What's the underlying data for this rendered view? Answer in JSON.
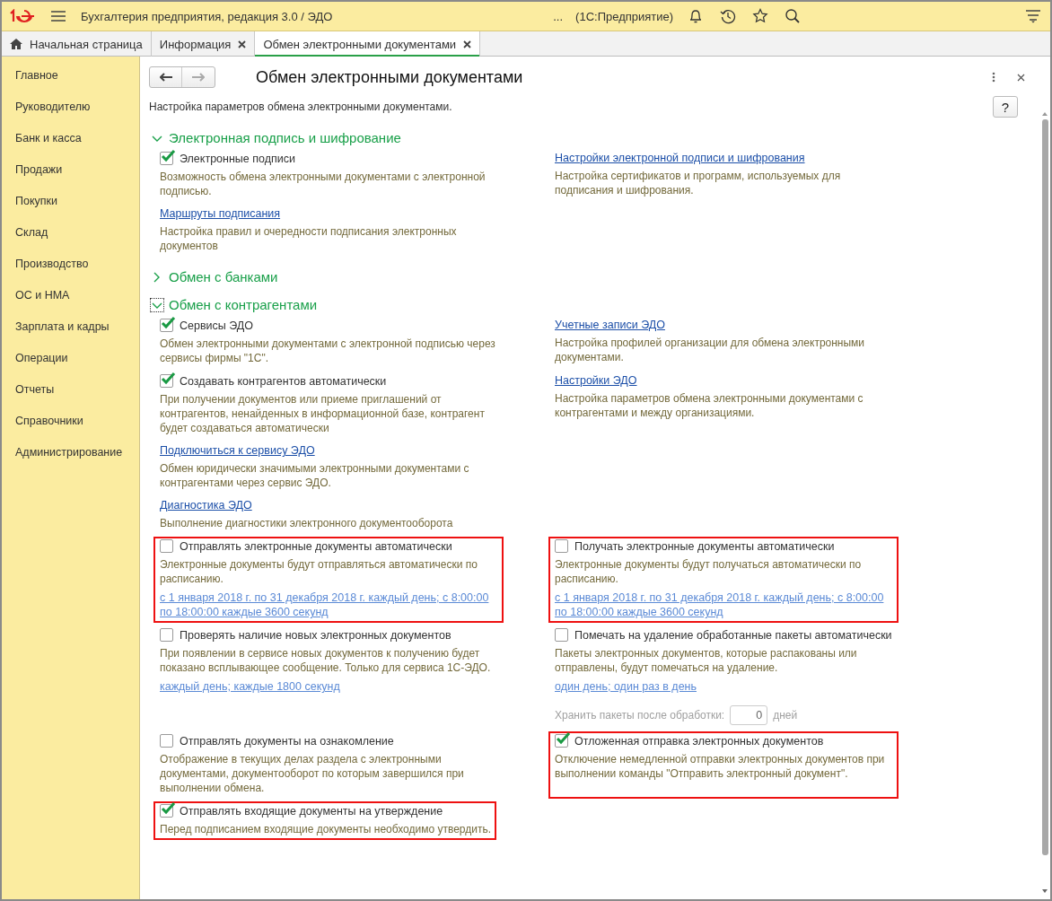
{
  "app_bar": {
    "title": "Бухгалтерия предприятия, редакция 3.0 / ЭДО",
    "ellipsis": "...",
    "platform": "(1С:Предприятие)"
  },
  "tabs": [
    {
      "label": "Начальная страница",
      "kind": "home",
      "selected": false
    },
    {
      "label": "Информация",
      "kind": "closable",
      "selected": false
    },
    {
      "label": "Обмен электронными документами",
      "kind": "closable",
      "selected": true
    }
  ],
  "sidebar": {
    "items": [
      "Главное",
      "Руководителю",
      "Банк и касса",
      "Продажи",
      "Покупки",
      "Склад",
      "Производство",
      "ОС и НМА",
      "Зарплата и кадры",
      "Операции",
      "Отчеты",
      "Справочники",
      "Администрирование"
    ]
  },
  "form": {
    "title": "Обмен электронными документами",
    "help": "?",
    "description": "Настройка параметров обмена электронными документами.",
    "sections": [
      {
        "title": "Электронная подпись и шифрование",
        "expanded": true,
        "focused": false,
        "rows": [
          {
            "left": {
              "highlighted": false,
              "items": [
                {
                  "kind": "checkbox",
                  "text": "Электронные подписи",
                  "checked": true
                },
                {
                  "kind": "note",
                  "text": "Возможность обмена электронными документами с электронной подписью."
                }
              ]
            },
            "right": {
              "highlighted": false,
              "items": [
                {
                  "kind": "link",
                  "text": "Настройки электронной подписи и шифрования"
                },
                {
                  "kind": "note",
                  "text": "Настройка сертификатов и программ, используемых для подписания и шифрования."
                }
              ]
            }
          },
          {
            "left": {
              "highlighted": false,
              "items": [
                {
                  "kind": "link",
                  "text": "Маршруты подписания"
                },
                {
                  "kind": "note",
                  "text": "Настройка правил и очередности подписания электронных документов"
                }
              ]
            }
          }
        ]
      },
      {
        "title": "Обмен с банками",
        "expanded": false,
        "focused": false
      },
      {
        "title": "Обмен с контрагентами",
        "expanded": true,
        "focused": true,
        "rows": [
          {
            "left": {
              "highlighted": false,
              "items": [
                {
                  "kind": "checkbox",
                  "text": "Сервисы ЭДО",
                  "checked": true
                },
                {
                  "kind": "note",
                  "text": "Обмен электронными документами с электронной подписью через сервисы фирмы \"1С\"."
                }
              ]
            },
            "right": {
              "highlighted": false,
              "items": [
                {
                  "kind": "link",
                  "text": "Учетные записи ЭДО"
                },
                {
                  "kind": "note",
                  "text": "Настройка профилей организации для обмена электронными документами."
                }
              ]
            }
          },
          {
            "left": {
              "highlighted": false,
              "items": [
                {
                  "kind": "checkbox",
                  "text": "Создавать контрагентов автоматически",
                  "checked": true
                },
                {
                  "kind": "note",
                  "text": "При получении документов или приеме приглашений от контрагентов, ненайденных в информационной базе, контрагент будет создаваться автоматически"
                }
              ]
            },
            "right": {
              "highlighted": false,
              "items": [
                {
                  "kind": "link",
                  "text": "Настройки ЭДО"
                },
                {
                  "kind": "note",
                  "text": "Настройка параметров обмена электронными документами с контрагентами и между организациями."
                }
              ]
            }
          },
          {
            "left": {
              "highlighted": false,
              "items": [
                {
                  "kind": "link",
                  "text": "Подключиться к сервису ЭДО"
                },
                {
                  "kind": "note",
                  "text": "Обмен юридически значимыми электронными документами с контрагентами через сервис ЭДО."
                }
              ]
            }
          },
          {
            "left": {
              "highlighted": false,
              "items": [
                {
                  "kind": "link",
                  "text": "Диагностика ЭДО"
                },
                {
                  "kind": "note",
                  "text": "Выполнение диагностики электронного документооборота"
                }
              ]
            }
          },
          {
            "left": {
              "highlighted": true,
              "items": [
                {
                  "kind": "checkbox",
                  "text": "Отправлять электронные документы автоматически",
                  "checked": false
                },
                {
                  "kind": "note",
                  "text": "Электронные документы будут отправляться автоматически по расписанию."
                },
                {
                  "kind": "schedule",
                  "text": "с 1 января 2018 г. по 31 декабря 2018 г. каждый день; с 8:00:00 по 18:00:00 каждые 3600 секунд"
                }
              ]
            },
            "right": {
              "highlighted": true,
              "items": [
                {
                  "kind": "checkbox",
                  "text": "Получать электронные документы автоматически",
                  "checked": false
                },
                {
                  "kind": "note",
                  "text": "Электронные документы будут получаться автоматически по расписанию."
                },
                {
                  "kind": "schedule",
                  "text": "с 1 января 2018 г. по 31 декабря 2018 г. каждый день; с 8:00:00 по 18:00:00 каждые 3600 секунд"
                }
              ]
            }
          },
          {
            "left": {
              "highlighted": false,
              "items": [
                {
                  "kind": "checkbox",
                  "text": "Проверять наличие новых электронных документов",
                  "checked": false
                },
                {
                  "kind": "note",
                  "text": "При появлении в сервисе новых документов к получению будет показано всплывающее сообщение. Только для сервиса 1С-ЭДО."
                },
                {
                  "kind": "schedule",
                  "text": "каждый день; каждые 1800 секунд"
                }
              ]
            },
            "right": {
              "highlighted": false,
              "items": [
                {
                  "kind": "checkbox",
                  "text": "Помечать на удаление обработанные пакеты автоматически",
                  "checked": false
                },
                {
                  "kind": "note",
                  "text": "Пакеты электронных документов, которые распакованы или отправлены, будут помечаться на удаление."
                },
                {
                  "kind": "schedule",
                  "text": "один день; один раз в день"
                },
                {
                  "kind": "retention",
                  "label": "Хранить пакеты после обработки:",
                  "value": "0",
                  "unit": "дней"
                }
              ]
            }
          },
          {
            "left": {
              "highlighted": false,
              "items": [
                {
                  "kind": "checkbox",
                  "text": "Отправлять документы на ознакомление",
                  "checked": false
                },
                {
                  "kind": "note",
                  "text": "Отображение в текущих делах  раздела с электронными документами, документооборот по которым завершился при выполнении обмена."
                }
              ]
            },
            "right": {
              "highlighted": true,
              "items": [
                {
                  "kind": "checkbox",
                  "text": "Отложенная отправка электронных документов",
                  "checked": true
                },
                {
                  "kind": "note",
                  "text": "Отключение немедленной отправки электронных документов при выполнении команды \"Отправить электронный документ\"."
                }
              ]
            }
          },
          {
            "left": {
              "highlighted": true,
              "items": [
                {
                  "kind": "checkbox",
                  "text": "Отправлять входящие документы на утверждение",
                  "checked": true
                },
                {
                  "kind": "note",
                  "text": "Перед подписанием входящие документы необходимо утвердить."
                }
              ]
            }
          }
        ]
      }
    ]
  }
}
